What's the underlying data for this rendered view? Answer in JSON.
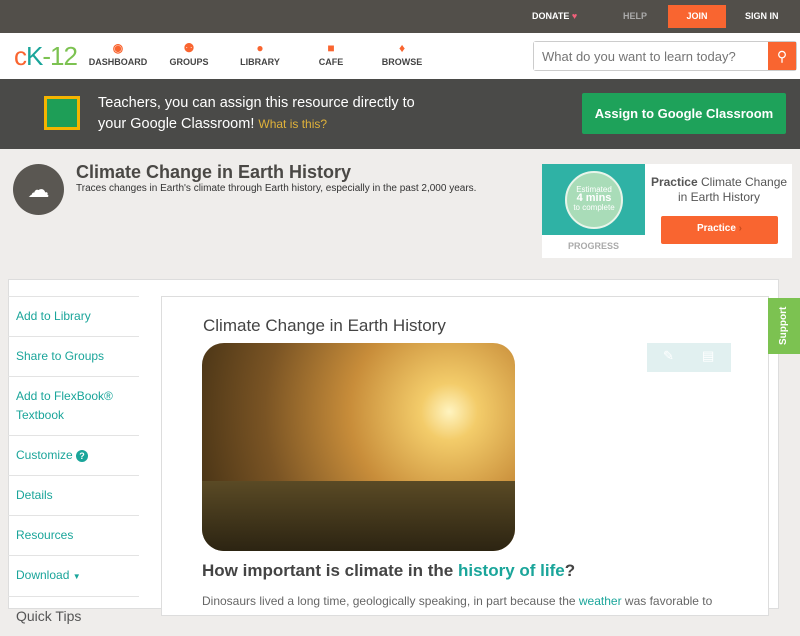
{
  "topbar": {
    "donate": "DONATE",
    "help": "HELP",
    "join": "JOIN",
    "signin": "SIGN IN"
  },
  "nav": {
    "logo": "cK-12",
    "items": [
      {
        "label": "DASHBOARD",
        "icon": "gauge-icon"
      },
      {
        "label": "GROUPS",
        "icon": "people-icon"
      },
      {
        "label": "LIBRARY",
        "icon": "backpack-icon"
      },
      {
        "label": "CAFE",
        "icon": "chat-icon"
      },
      {
        "label": "BROWSE",
        "icon": "bulb-icon"
      }
    ],
    "search_placeholder": "What do you want to learn today?"
  },
  "banner": {
    "line1": "Teachers, you can assign this resource directly to",
    "line2": "your Google Classroom!",
    "link": "What is this?",
    "button": "Assign to Google Classroom"
  },
  "header": {
    "title": "Climate Change in Earth History",
    "desc": "Traces changes in Earth's climate through Earth history, especially in the past 2,000 years."
  },
  "practice": {
    "est1": "Estimated",
    "est2": "4 mins",
    "est3": "to complete",
    "progress": "PROGRESS",
    "title_bold": "Practice",
    "title_rest": "Climate Change in Earth History",
    "button": "Practice"
  },
  "sidebar": {
    "items": [
      "Add to Library",
      "Share to Groups",
      "Add to FlexBook® Textbook",
      "Customize",
      "Details",
      "Resources",
      "Download"
    ],
    "quick_tips": "Quick Tips"
  },
  "content": {
    "title": "Climate Change in Earth History",
    "question_pre": "How important is climate in the ",
    "question_link": "history of life",
    "question_post": "?",
    "para_pre": "Dinosaurs lived a long time, geologically speaking, in part because the ",
    "para_link": "weather",
    "para_post": " was favorable to"
  },
  "support": "Support",
  "colors": {
    "accent": "#f96530",
    "teal": "#1aa59a",
    "green": "#1ea25a"
  }
}
